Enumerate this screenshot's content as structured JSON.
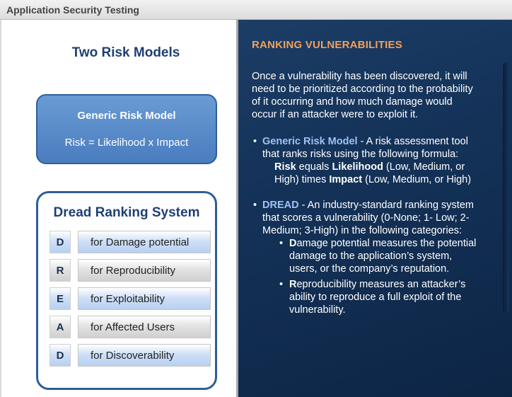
{
  "window": {
    "title": "Application Security Testing"
  },
  "left": {
    "title": "Two Risk Models",
    "generic": {
      "title": "Generic Risk Model",
      "formula": "Risk = Likelihood x Impact"
    },
    "dread": {
      "title": "Dread Ranking System",
      "rows": [
        {
          "letter": "D",
          "label": "for Damage potential"
        },
        {
          "letter": "R",
          "label": "for Reproducibility"
        },
        {
          "letter": "E",
          "label": "for Exploitability"
        },
        {
          "letter": "A",
          "label": "for Affected Users"
        },
        {
          "letter": "D",
          "label": "for Discoverability"
        }
      ]
    }
  },
  "right": {
    "title": "RANKING VULNERABILITIES",
    "intro": "Once a vulnerability has been discovered, it will need to be prioritized according to the probability of it occurring and how much damage would occur if an attacker were to exploit it.",
    "bullet1": {
      "term": "Generic Risk Model",
      "text": " - A risk assessment tool that ranks risks using the following formula:",
      "formula_parts": [
        "Risk",
        " equals ",
        "Likelihood",
        " (Low, Medium, or High) times ",
        "Impact",
        " (Low, Medium, or High)"
      ]
    },
    "bullet2": {
      "term": "DREAD",
      "text": " - An industry-standard ranking system that scores a vulnerability (0-None; 1- Low; 2-Medium; 3-High) in the following categories:",
      "sub": [
        {
          "letter": "D",
          "text": "amage potential measures the potential damage to the application’s system, users, or the company’s reputation."
        },
        {
          "letter": "R",
          "text": "eproducibility measures an attacker’s ability to reproduce a full exploit of the vulnerability."
        }
      ]
    }
  }
}
